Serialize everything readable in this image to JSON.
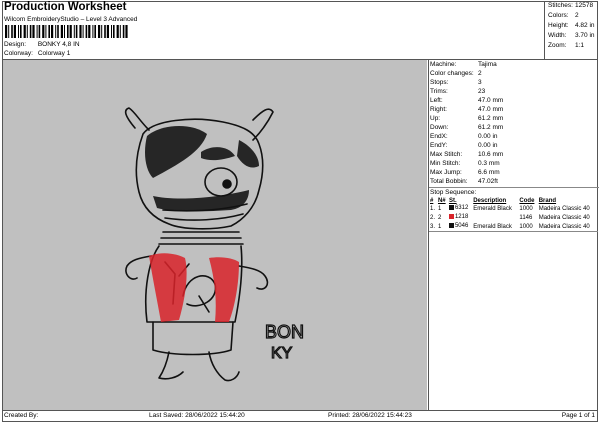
{
  "header": {
    "title": "Production Worksheet",
    "subtitle": "Wilcom EmbroideryStudio – Level 3 Advanced",
    "design_label": "Design:",
    "design_value": "BONKY 4,8 IN",
    "colorway_label": "Colorway:",
    "colorway_value": "Colorway 1"
  },
  "stats": [
    {
      "label": "Stitches:",
      "value": "12578"
    },
    {
      "label": "Colors:",
      "value": "2"
    },
    {
      "label": "Height:",
      "value": "4.82 in"
    },
    {
      "label": "Width:",
      "value": "3.70 in"
    },
    {
      "label": "Zoom:",
      "value": "1:1"
    }
  ],
  "machine_info": [
    {
      "label": "Machine:",
      "value": "Tajima"
    },
    {
      "label": "Color changes:",
      "value": "2"
    },
    {
      "label": "Stops:",
      "value": "3"
    },
    {
      "label": "Trims:",
      "value": "23"
    },
    {
      "label": "Left:",
      "value": "47.0 mm"
    },
    {
      "label": "Right:",
      "value": "47.0 mm"
    },
    {
      "label": "Up:",
      "value": "61.2 mm"
    },
    {
      "label": "Down:",
      "value": "61.2 mm"
    },
    {
      "label": "EndX:",
      "value": "0.00 in"
    },
    {
      "label": "EndY:",
      "value": "0.00 in"
    },
    {
      "label": "Max Stitch:",
      "value": "10.6 mm"
    },
    {
      "label": "Min Stitch:",
      "value": "0.3 mm"
    },
    {
      "label": "Max Jump:",
      "value": "6.6 mm"
    },
    {
      "label": "Total Bobbin:",
      "value": "47.02ft"
    }
  ],
  "stop_sequence": {
    "title": "Stop Sequence:",
    "headers": [
      "#",
      "N#",
      "St.",
      "Description",
      "Code",
      "Brand"
    ],
    "rows": [
      {
        "num": "1.",
        "n": "1",
        "color": "#111111",
        "st": "6312",
        "desc": "Emerald Black",
        "code": "1000",
        "brand": "Madeira Classic 40"
      },
      {
        "num": "2.",
        "n": "2",
        "color": "#d9232a",
        "st": "1218",
        "desc": "",
        "code": "1146",
        "brand": "Madeira Classic 40"
      },
      {
        "num": "3.",
        "n": "1",
        "color": "#111111",
        "st": "5046",
        "desc": "Emerald Black",
        "code": "1000",
        "brand": "Madeira Classic 40"
      }
    ]
  },
  "design_text": {
    "line1": "BON",
    "line2": "KY"
  },
  "colors": {
    "canvas": "#c0c0c0",
    "thread_black": "#111111",
    "thread_red": "#d9232a"
  },
  "footer": {
    "created": "Created By:",
    "saved": "Last Saved: 28/06/2022 15:44:20",
    "printed": "Printed: 28/06/2022 15:44:23",
    "page": "Page 1 of 1"
  }
}
